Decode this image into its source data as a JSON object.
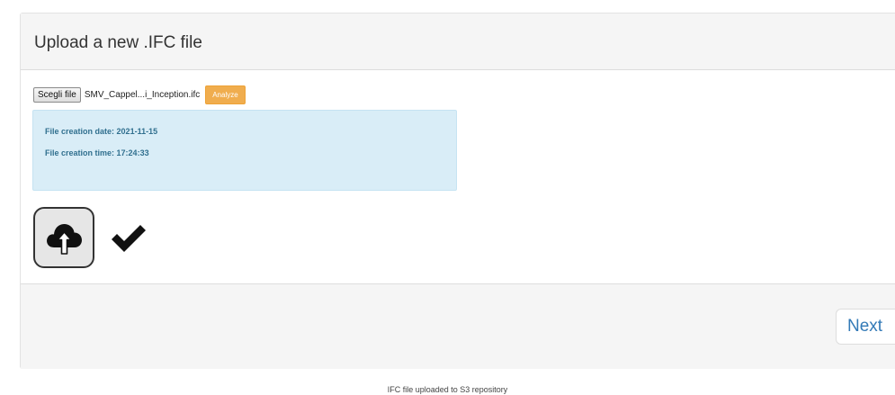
{
  "panel": {
    "title": "Upload a new .IFC file"
  },
  "file_input": {
    "choose_label": "Scegli file",
    "file_name": "SMV_Cappel...i_Inception.ifc"
  },
  "analyze_button": {
    "label": "Analyze",
    "color": "#f0ad4e"
  },
  "info": {
    "creation_date_label": "File creation date:",
    "creation_date": "2021-11-15",
    "creation_time_label": "File creation time:",
    "creation_time": "17:24:33",
    "background_color": "#d9edf7",
    "text_color": "#31708f"
  },
  "actions": {
    "upload_icon": "cloud-upload-icon",
    "status_icon": "checkmark-icon"
  },
  "footer": {
    "next_label": "Next"
  },
  "status": {
    "message": "IFC file uploaded to S3 repository"
  }
}
